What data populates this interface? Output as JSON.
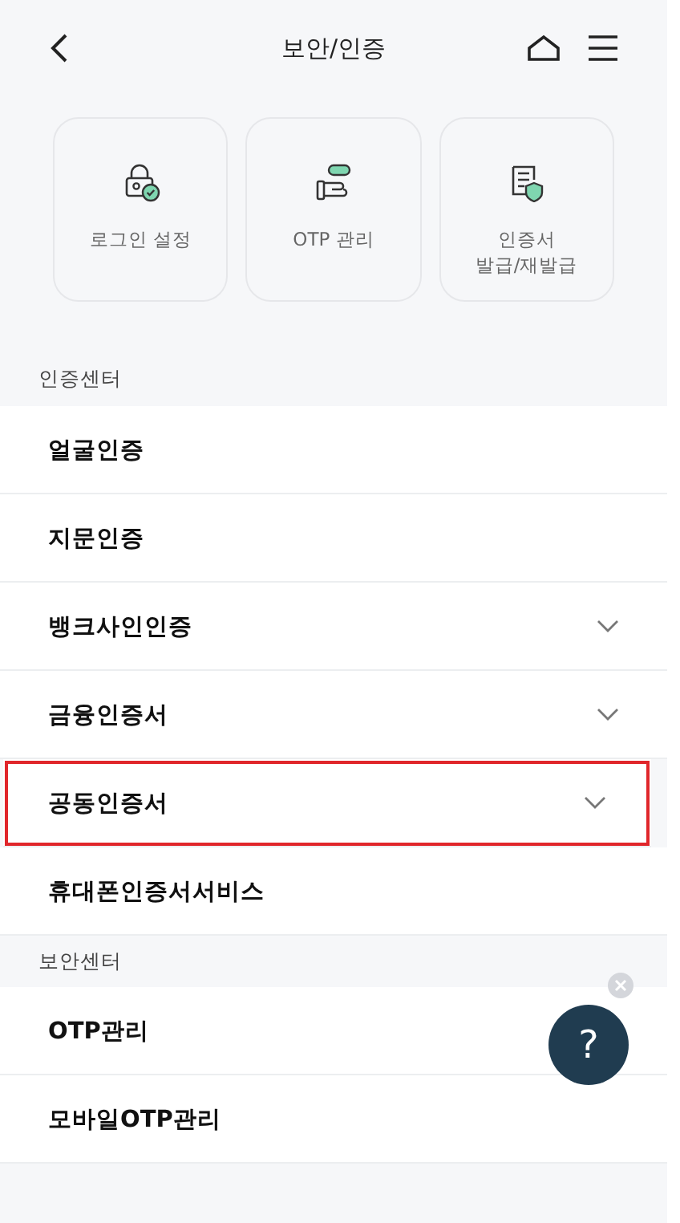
{
  "header": {
    "title": "보안/인증"
  },
  "shortcuts": [
    {
      "kind": "lock",
      "label": "로그인 설정"
    },
    {
      "kind": "otp",
      "label": "OTP 관리"
    },
    {
      "kind": "certificate",
      "label": "인증서\n발급/재발급"
    }
  ],
  "sections": [
    {
      "title": "인증센터",
      "items": [
        {
          "label": "얼굴인증",
          "expandable": false,
          "highlighted": false
        },
        {
          "label": "지문인증",
          "expandable": false,
          "highlighted": false
        },
        {
          "label": "뱅크사인인증",
          "expandable": true,
          "highlighted": false
        },
        {
          "label": "금융인증서",
          "expandable": true,
          "highlighted": false
        },
        {
          "label": "공동인증서",
          "expandable": true,
          "highlighted": true
        },
        {
          "label": "휴대폰인증서서비스",
          "expandable": false,
          "highlighted": false
        }
      ]
    },
    {
      "title": "보안센터",
      "items": [
        {
          "label": "OTP관리",
          "highlighted": false
        },
        {
          "label": "모바일OTP관리",
          "highlighted": false
        }
      ]
    }
  ],
  "help_button": {
    "label": "?"
  }
}
